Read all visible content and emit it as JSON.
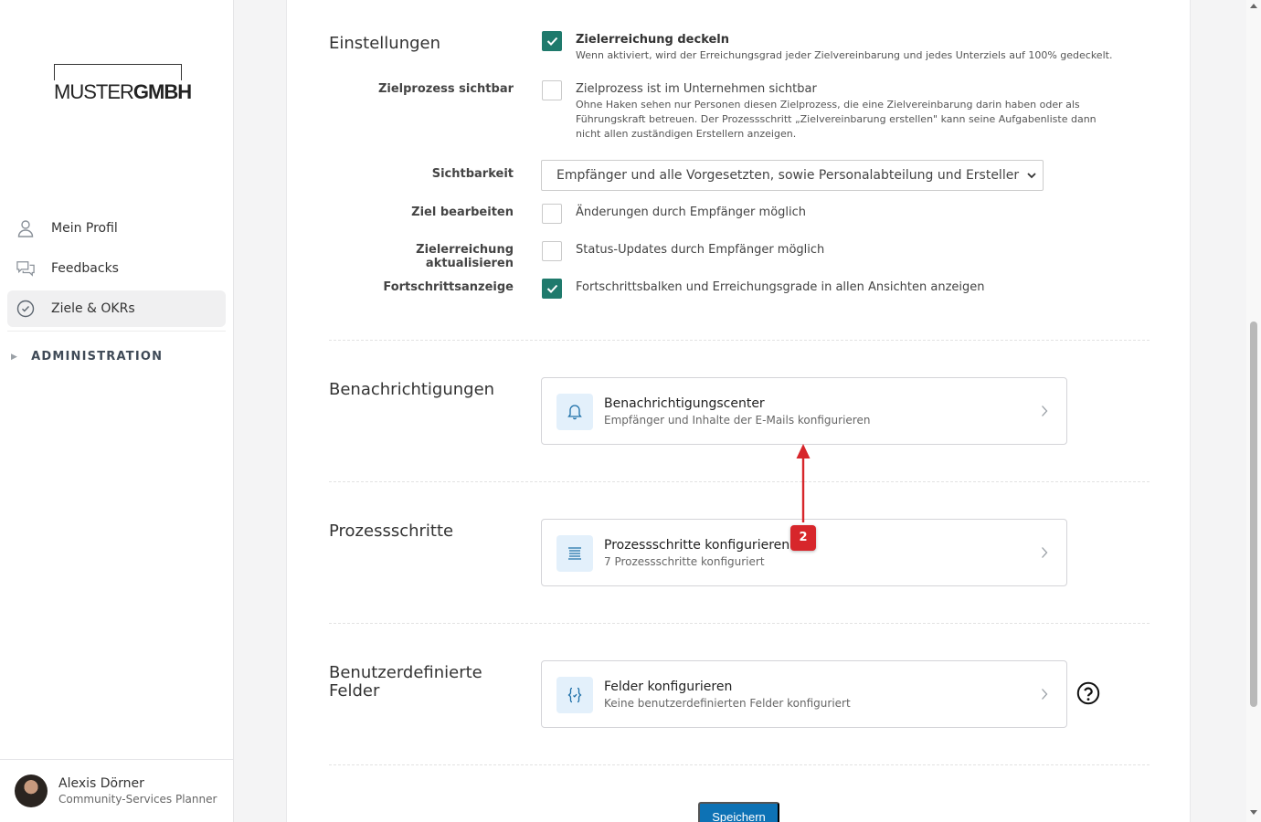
{
  "logo": {
    "light": "MUSTER",
    "bold": "GMBH"
  },
  "nav": [
    {
      "label": "Mein Profil",
      "icon": "user-icon",
      "active": false
    },
    {
      "label": "Feedbacks",
      "icon": "chat-icon",
      "active": false
    },
    {
      "label": "Ziele & OKRs",
      "icon": "check-circle-icon",
      "active": true
    }
  ],
  "admin": {
    "label": "ADMINISTRATION"
  },
  "user": {
    "name": "Alexis Dörner",
    "role": "Community-Services Planner"
  },
  "settings": {
    "title": "Einstellungen",
    "cap": {
      "option": "Zielerreichung deckeln",
      "description": "Wenn aktiviert, wird der Erreichungsgrad jeder Zielvereinbarung und jedes Unterziels auf 100% gedeckelt.",
      "checked": true
    },
    "visible_process": {
      "label": "Zielprozess sichtbar",
      "option": "Zielprozess ist im Unternehmen sichtbar",
      "description": "Ohne Haken sehen nur Personen diesen Zielprozess, die eine Zielvereinbarung darin haben oder als Führungskraft betreuen. Der Prozessschritt „Zielvereinbarung erstellen\" kann seine Aufgabenliste dann nicht allen zuständigen Erstellern anzeigen.",
      "checked": false
    },
    "visibility": {
      "label": "Sichtbarkeit",
      "value": "Empfänger und alle Vorgesetzten, sowie Personalabteilung und Ersteller"
    },
    "edit_goal": {
      "label": "Ziel bearbeiten",
      "option": "Änderungen durch Empfänger möglich",
      "checked": false
    },
    "update_progress": {
      "label": "Zielerreichung aktualisieren",
      "option": "Status-Updates durch Empfänger möglich",
      "checked": false
    },
    "progress_display": {
      "label": "Fortschrittsanzeige",
      "option": "Fortschrittsbalken und Erreichungsgrade in allen Ansichten anzeigen",
      "checked": true
    }
  },
  "notifications": {
    "title": "Benachrichtigungen",
    "tile_title": "Benachrichtigungscenter",
    "tile_sub": "Empfänger und Inhalte der E-Mails konfigurieren"
  },
  "process_steps": {
    "title": "Prozessschritte",
    "tile_title": "Prozessschritte konfigurieren",
    "tile_sub": "7 Prozessschritte konfiguriert"
  },
  "custom_fields": {
    "title_line1": "Benutzerdefinierte",
    "title_line2": "Felder",
    "tile_title": "Felder konfigurieren",
    "tile_sub": "Keine benutzerdefinierten Felder konfiguriert"
  },
  "save_label": "Speichern",
  "annotation": {
    "badge": "2"
  },
  "colors": {
    "accent": "#1f7a6c",
    "primary": "#0d72b5",
    "annotation": "#d7262b"
  }
}
